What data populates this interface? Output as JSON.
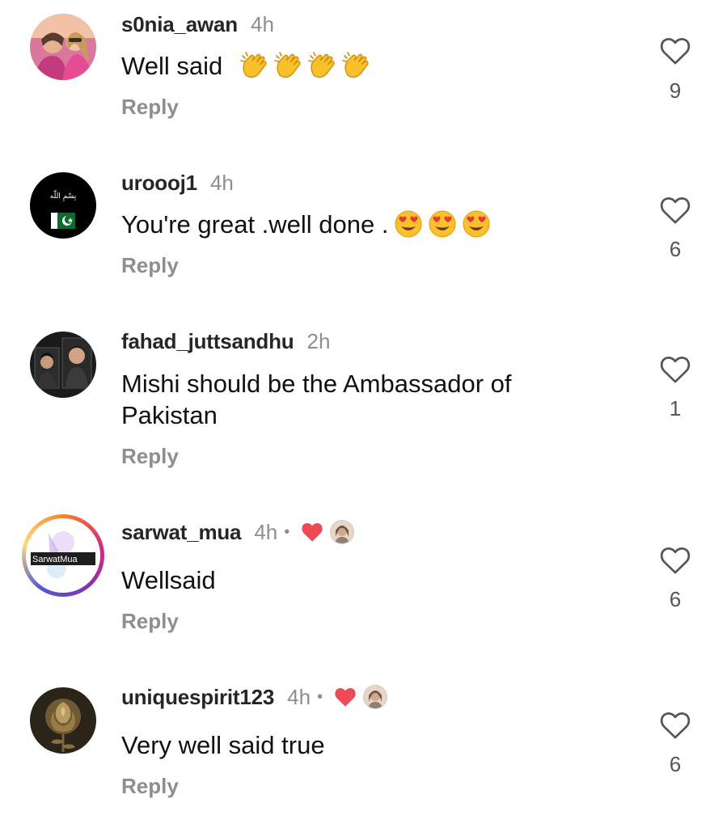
{
  "comments": [
    {
      "username": "s0nia_awan",
      "time": "4h",
      "text": "Well said",
      "emoji": [
        "clap",
        "clap",
        "clap",
        "clap"
      ],
      "reply": "Reply",
      "likes": "9"
    },
    {
      "username": "uroooj1",
      "time": "4h",
      "text": "You're great .well done .",
      "emoji": [
        "heart-eyes",
        "heart-eyes",
        "heart-eyes"
      ],
      "reply": "Reply",
      "likes": "6",
      "avatar_text": "بِسْمِ اللّٰه",
      "avatar_flag": "pakistan"
    },
    {
      "username": "fahad_juttsandhu",
      "time": "2h",
      "text": "Mishi should be the Ambassador of Pakistan",
      "reply": "Reply",
      "likes": "1"
    },
    {
      "username": "sarwat_mua",
      "time": "4h",
      "dot": "•",
      "creator_liked": true,
      "text": "Wellsaid",
      "reply": "Reply",
      "likes": "6",
      "avatar_text": "SarwatMua"
    },
    {
      "username": "uniquespirit123",
      "time": "4h",
      "dot": "•",
      "creator_liked": true,
      "text": "Very well said true",
      "reply": "Reply",
      "likes": "6"
    }
  ],
  "colors": {
    "username": "#262626",
    "muted": "#8e8e8e",
    "liked_red": "#ed4956"
  },
  "icons": {
    "like": "heart-outline-icon",
    "creator_like": "heart-filled-icon"
  }
}
